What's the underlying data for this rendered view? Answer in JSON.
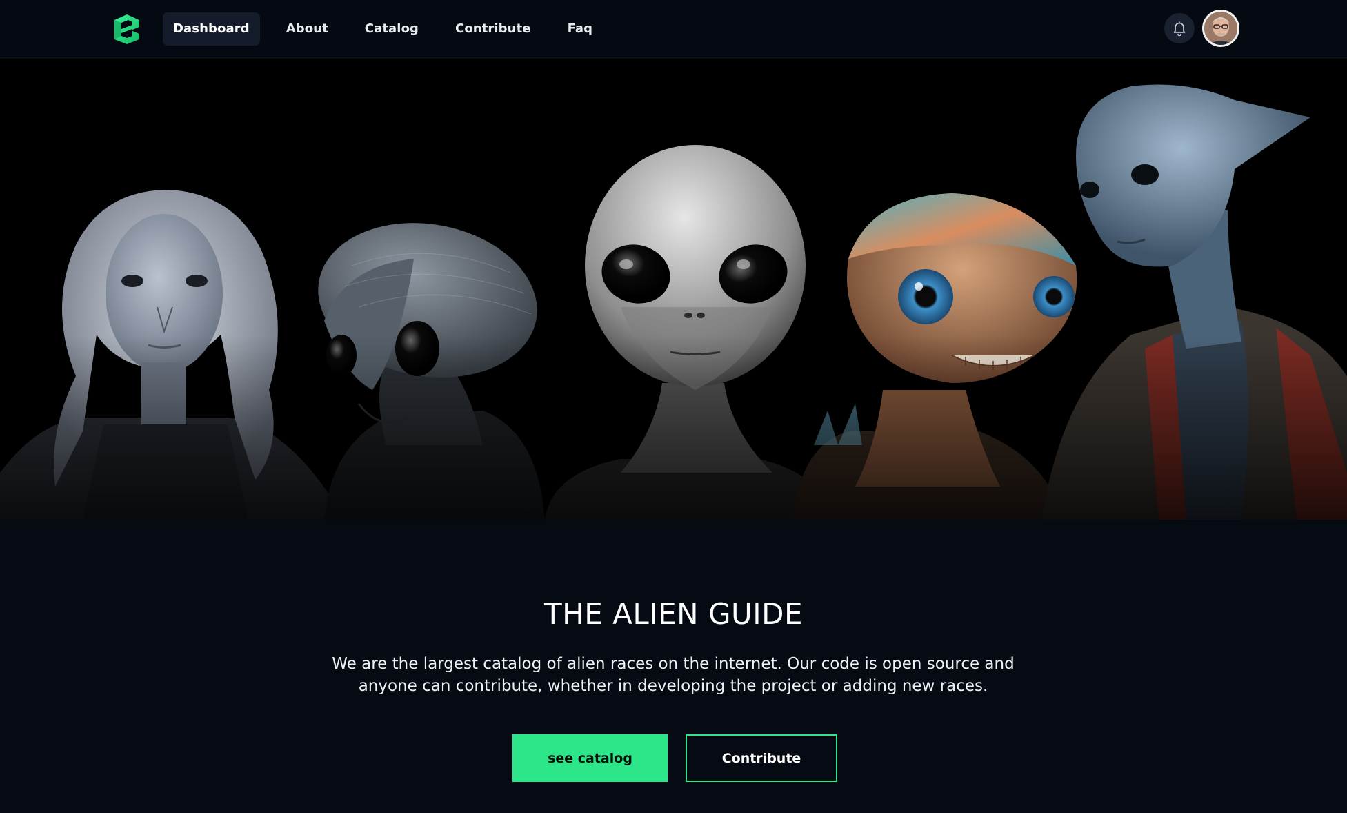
{
  "nav": {
    "logo": "brand-logo",
    "links": [
      {
        "label": "Dashboard",
        "active": true
      },
      {
        "label": "About",
        "active": false
      },
      {
        "label": "Catalog",
        "active": false
      },
      {
        "label": "Contribute",
        "active": false
      },
      {
        "label": "Faq",
        "active": false
      }
    ],
    "bell_icon": "bell-icon",
    "avatar_icon": "user-avatar"
  },
  "hero": {
    "image": "alien-races-lineup"
  },
  "main": {
    "title": "THE ALIEN GUIDE",
    "description": "We are the largest catalog of alien races on the internet. Our code is open source and anyone can contribute, whether in developing the project or adding new races.",
    "primary_button": "see catalog",
    "secondary_button": "Contribute"
  },
  "colors": {
    "accent": "#2ee68a",
    "background": "#060b13",
    "nav_active_bg": "#141b2b"
  }
}
